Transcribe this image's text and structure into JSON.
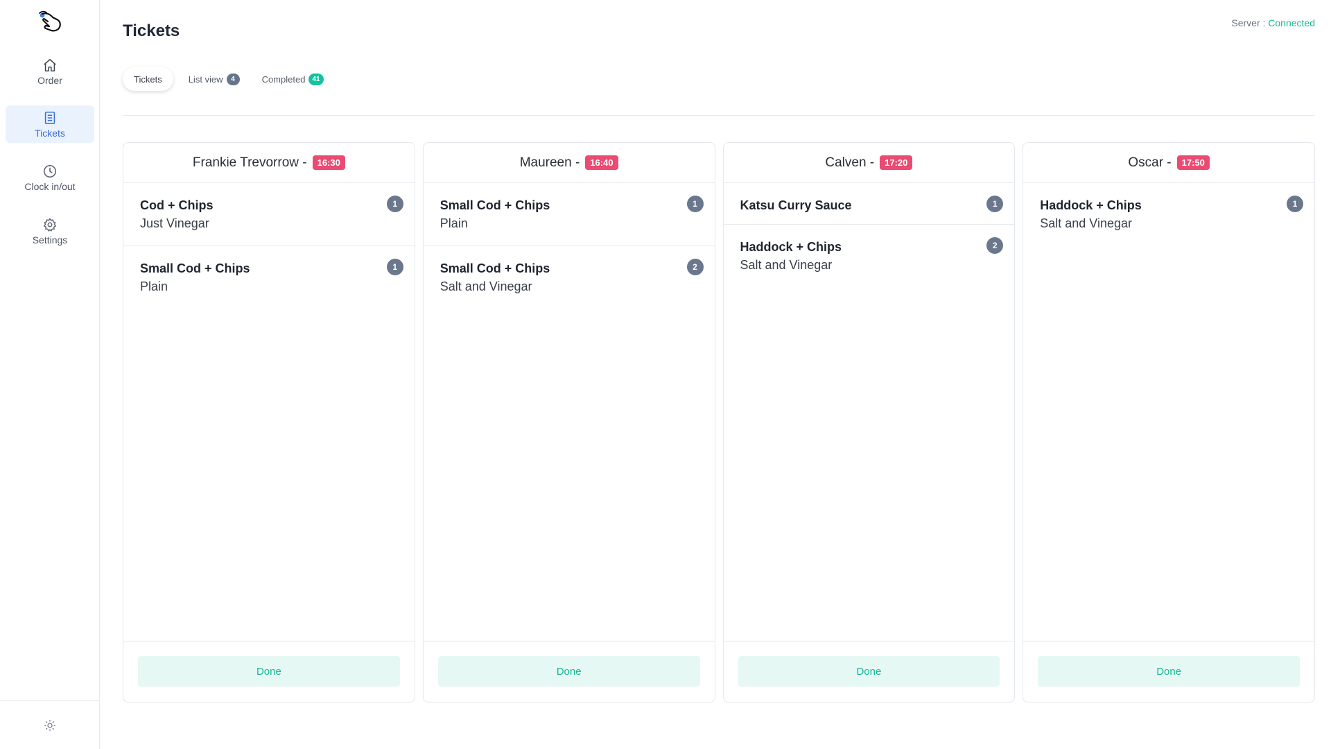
{
  "sidebar": {
    "logo_icon": "hand-pointer-icon",
    "items": [
      {
        "label": "Order",
        "icon": "home-icon"
      },
      {
        "label": "Tickets",
        "icon": "tickets-icon",
        "active": true
      },
      {
        "label": "Clock in/out",
        "icon": "clock-icon"
      },
      {
        "label": "Settings",
        "icon": "gear-icon"
      }
    ],
    "bottom_icon": "sun-icon"
  },
  "header": {
    "title": "Tickets",
    "server_label": "Server : ",
    "server_status": "Connected"
  },
  "tabs": [
    {
      "label": "Tickets",
      "active": true
    },
    {
      "label": "List view",
      "count": "4"
    },
    {
      "label": "Completed",
      "count": "41"
    }
  ],
  "tickets": [
    {
      "customer": "Frankie Trevorrow -",
      "time": "16:30",
      "items": [
        {
          "name": "Cod + Chips",
          "modifier": "Just Vinegar",
          "qty": "1"
        },
        {
          "name": "Small Cod + Chips",
          "modifier": "Plain",
          "qty": "1"
        }
      ],
      "done_label": "Done"
    },
    {
      "customer": "Maureen -",
      "time": "16:40",
      "items": [
        {
          "name": "Small Cod + Chips",
          "modifier": "Plain",
          "qty": "1"
        },
        {
          "name": "Small Cod + Chips",
          "modifier": "Salt and Vinegar",
          "qty": "2"
        }
      ],
      "done_label": "Done"
    },
    {
      "customer": "Calven -",
      "time": "17:20",
      "items": [
        {
          "name": "Katsu Curry Sauce",
          "modifier": "",
          "qty": "1"
        },
        {
          "name": "Haddock + Chips",
          "modifier": "Salt and Vinegar",
          "qty": "2"
        }
      ],
      "done_label": "Done"
    },
    {
      "customer": "Oscar -",
      "time": "17:50",
      "items": [
        {
          "name": "Haddock + Chips",
          "modifier": "Salt and Vinegar",
          "qty": "1"
        }
      ],
      "done_label": "Done"
    }
  ],
  "colors": {
    "accent_blue": "#3b6fd1",
    "success_green": "#13b89a",
    "time_badge": "#eb4a72",
    "qty_badge": "#6b778c"
  }
}
